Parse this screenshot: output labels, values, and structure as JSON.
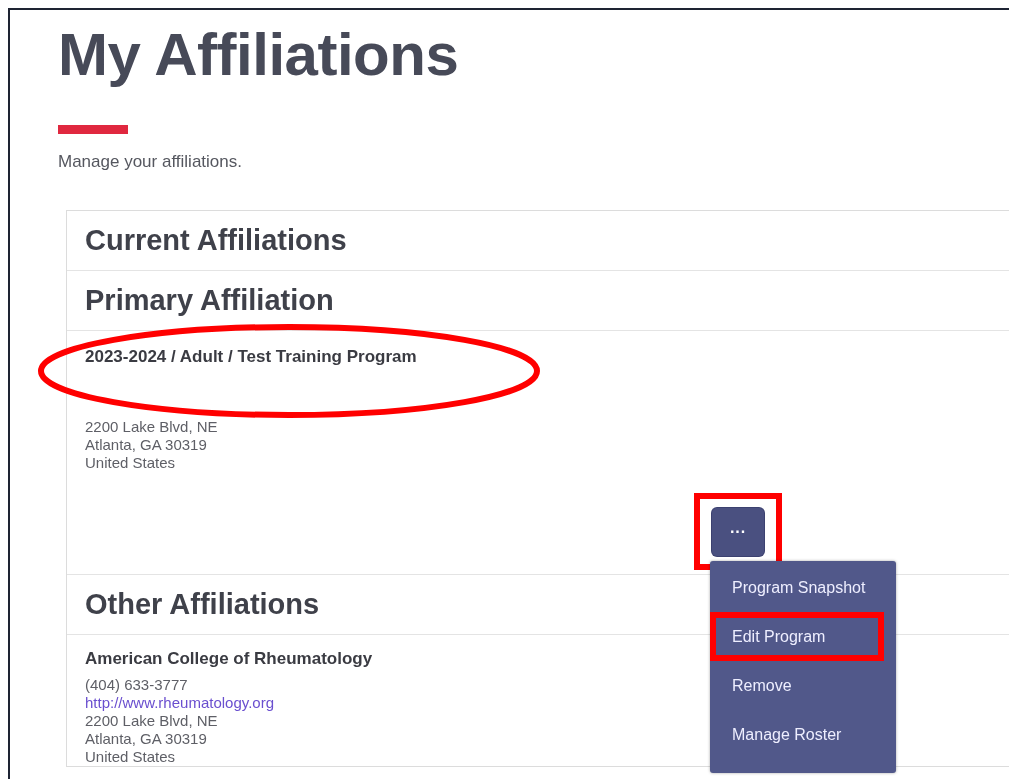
{
  "page": {
    "title": "My Affiliations",
    "subtitle": "Manage your affiliations."
  },
  "card": {
    "heading": "Current Affiliations",
    "primary": {
      "heading": "Primary Affiliation",
      "program": "2023-2024 / Adult / Test Training Program",
      "program_circled": true,
      "address": [
        "2200 Lake Blvd, NE",
        "Atlanta, GA 30319",
        "United States"
      ],
      "menu_button": {
        "label": "···",
        "highlighted": true,
        "expanded": true
      },
      "menu": [
        {
          "label": "Program Snapshot",
          "highlighted": false
        },
        {
          "label": "Edit Program",
          "highlighted": true
        },
        {
          "label": "Remove",
          "highlighted": false
        },
        {
          "label": "Manage Roster",
          "highlighted": false
        }
      ]
    },
    "other": {
      "heading": "Other Affiliations",
      "items": [
        {
          "name": "American College of Rheumatology",
          "phone": "(404) 633-3777",
          "url": "http://www.rheumatology.org",
          "address": [
            "2200 Lake Blvd, NE",
            "Atlanta, GA 30319",
            "United States"
          ]
        }
      ]
    }
  }
}
